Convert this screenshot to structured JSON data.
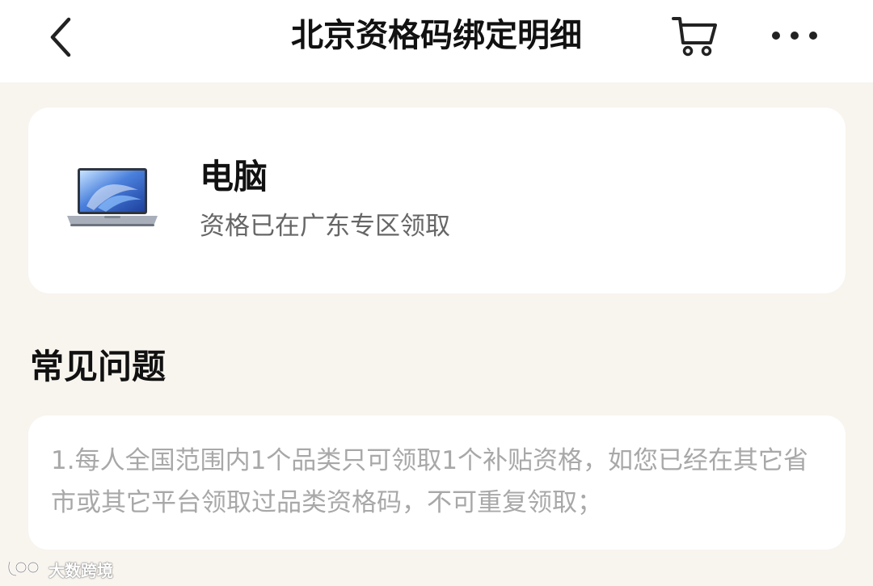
{
  "header": {
    "title": "北京资格码绑定明细",
    "back_icon": "chevron-left-icon",
    "cart_icon": "cart-icon",
    "more_icon": "more-icon"
  },
  "product_card": {
    "image_icon": "laptop-image",
    "title": "电脑",
    "status": "资格已在广东专区领取"
  },
  "faq": {
    "heading": "常见问题",
    "items": [
      "1.每人全国范围内1个品类只可领取1个补贴资格，如您已经在其它省市或其它平台领取过品类资格码，不可重复领取；"
    ]
  },
  "watermark": {
    "text": "大数跨境"
  },
  "colors": {
    "page_background": "#f8f4ee",
    "card_background": "#ffffff",
    "title_text": "#111111",
    "secondary_text": "#666666",
    "muted_text": "#a8a8a8"
  }
}
